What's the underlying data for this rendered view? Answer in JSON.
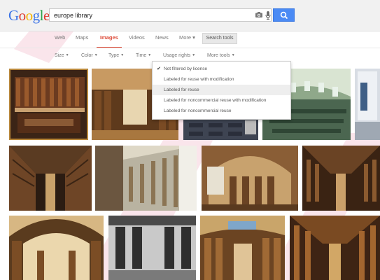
{
  "search": {
    "query": "europe library"
  },
  "tabs": [
    {
      "label": "Web"
    },
    {
      "label": "Maps"
    },
    {
      "label": "Images"
    },
    {
      "label": "Videos"
    },
    {
      "label": "News"
    },
    {
      "label": "More ▾"
    }
  ],
  "search_tools_label": "Search tools",
  "tools": [
    {
      "label": "Size"
    },
    {
      "label": "Color"
    },
    {
      "label": "Type"
    },
    {
      "label": "Time"
    },
    {
      "label": "Usage rights"
    },
    {
      "label": "More tools"
    }
  ],
  "usage_rights_menu": [
    {
      "label": "Not filtered by license",
      "selected": true
    },
    {
      "label": "Labeled for reuse with modification",
      "selected": false
    },
    {
      "label": "Labeled for reuse",
      "selected": false,
      "hover": true
    },
    {
      "label": "Labeled for noncommercial reuse with modification",
      "selected": false
    },
    {
      "label": "Labeled for noncommercial reuse",
      "selected": false
    }
  ],
  "colors": {
    "accent_blue": "#4a8af4",
    "active_tab_red": "#dd4b39",
    "logo": [
      "#3b73e6",
      "#dd3b2f",
      "#f5b400",
      "#3b73e6",
      "#2aa34a",
      "#dd3b2f"
    ]
  },
  "results": [
    {
      "name": "result-image-1",
      "theme": "long-hall"
    },
    {
      "name": "result-image-2",
      "theme": "ornate-hall"
    },
    {
      "name": "result-image-3",
      "theme": "reading-room"
    },
    {
      "name": "result-image-4",
      "theme": "domed-room"
    },
    {
      "name": "result-image-5",
      "theme": "side-shelves"
    },
    {
      "name": "result-image-6",
      "theme": "long-vault"
    },
    {
      "name": "result-image-7",
      "theme": "corridor"
    },
    {
      "name": "result-image-8",
      "theme": "arched-hall"
    },
    {
      "name": "result-image-9",
      "theme": "vault-dark"
    },
    {
      "name": "result-image-10",
      "theme": "golden-arch"
    },
    {
      "name": "result-image-11",
      "theme": "bw-room"
    },
    {
      "name": "result-image-12",
      "theme": "painted-ceiling"
    },
    {
      "name": "result-image-13",
      "theme": "deep-vault"
    }
  ]
}
